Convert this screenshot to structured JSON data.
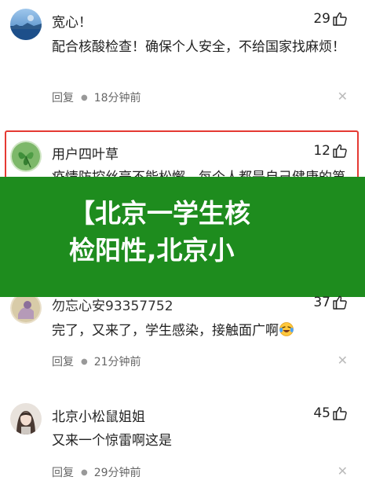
{
  "comments": [
    {
      "username": "宽心！",
      "likes": "29",
      "content": "配合核酸检查！确保个人安全，不给国家找麻烦！",
      "reply_label": "回复",
      "time": "18分钟前"
    },
    {
      "username": "用户四叶草",
      "likes": "12",
      "content": "疫情防控丝毫不能松懈，每个人都是自己健康的第一责任人，切实做好个人防护措施，愿疫情早日结束"
    },
    {
      "username": "勿忘心安93357752",
      "likes": "37",
      "content": "完了，又来了，学生感染，接触面广啊",
      "reply_label": "回复",
      "time": "21分钟前"
    },
    {
      "username": "北京小松鼠姐姐",
      "likes": "45",
      "content": "又来一个惊雷啊这是",
      "reply_label": "回复",
      "time": "29分钟前"
    }
  ],
  "banner": {
    "title_line1": "【北京一学生核",
    "title_line2": "检阳性,北京小"
  },
  "icons": {
    "like": "thumbs-up-icon",
    "close": "close-icon",
    "emoji": "laughing-crying-emoji-icon"
  },
  "colors": {
    "highlight_border": "#e53a33",
    "banner_bg": "#1e8c1e"
  }
}
